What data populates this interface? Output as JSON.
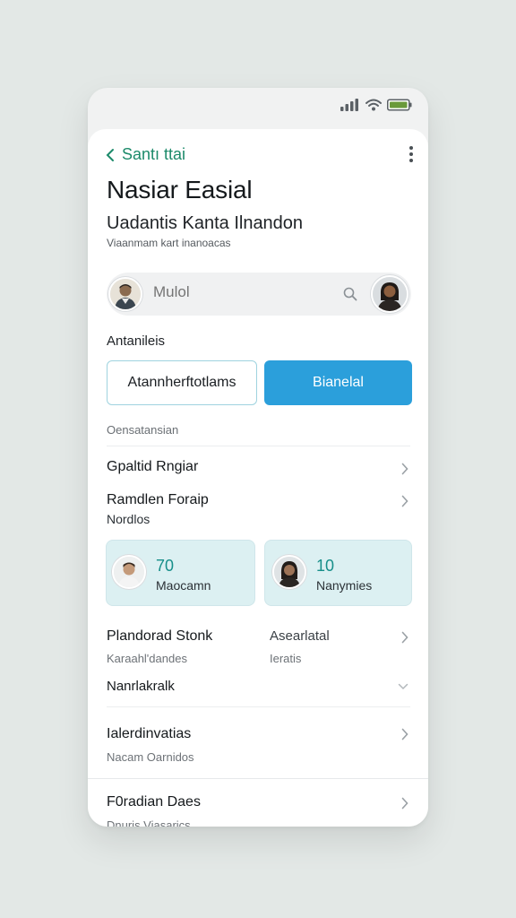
{
  "status_bar": {
    "signal_icon": "signal-icon",
    "wifi_icon": "wifi-icon",
    "battery_icon": "battery-icon"
  },
  "header": {
    "back_label": "Santı ttai",
    "more_icon": "more-vertical-icon",
    "title": "Nasiar Easial",
    "subtitle": "Uadantis Kanta Ilnandon",
    "caption": "Viaanmam kart inanoacas"
  },
  "search": {
    "placeholder": "Mulol",
    "icon": "search-icon"
  },
  "actions": {
    "section_label": "Antanileis",
    "secondary_label": "Atannherftotlams",
    "primary_label": "Bianelal"
  },
  "list": {
    "group_label": "Oensatansian",
    "rows": [
      {
        "title": "Gpaltid Rngiar"
      },
      {
        "title": "Ramdlen Foraip",
        "subtitle": "Nordlos"
      }
    ]
  },
  "cards": [
    {
      "value": "70",
      "label": "Maocamn"
    },
    {
      "value": "10",
      "label": "Nanymies"
    }
  ],
  "details": {
    "row1_left_title": "Plandorad Stonk",
    "row1_left_sub": "Karaahl'dandes",
    "row1_right_title": "Asearlatal",
    "row1_right_sub": "Ieratis",
    "row2_title": "Nanrlakralk",
    "row3_title": "Ialerdinvatias",
    "row3_sub": "Nacam Oarnidos",
    "row4_title": "F0radian Daes",
    "row4_sub": "Dnuris Viasarics"
  },
  "colors": {
    "accent_green": "#1c8a6a",
    "primary_blue": "#2b9fdb",
    "card_bg": "#dcf0f2",
    "card_number": "#178f8a"
  }
}
